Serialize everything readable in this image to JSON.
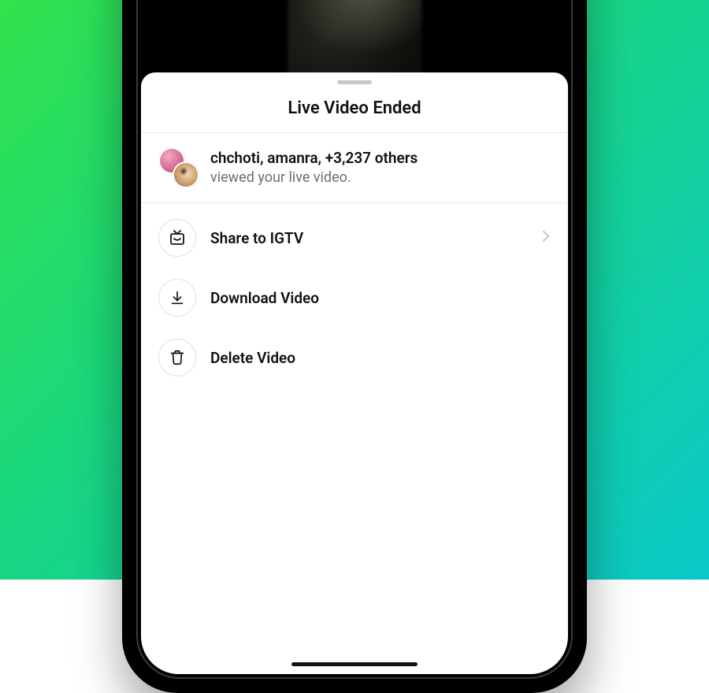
{
  "sheet": {
    "title": "Live Video Ended"
  },
  "viewers": {
    "summary_bold": "chchoti, amanra, +3,237 others",
    "subtitle": "viewed your live video."
  },
  "actions": {
    "share": {
      "label": "Share to IGTV"
    },
    "download": {
      "label": "Download Video"
    },
    "delete": {
      "label": "Delete Video"
    }
  }
}
